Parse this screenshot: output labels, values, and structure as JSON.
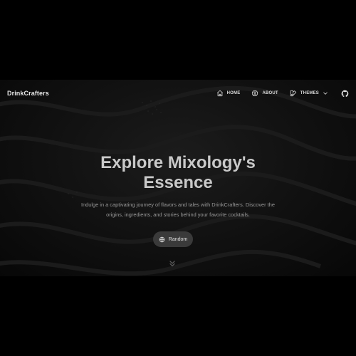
{
  "brand": "DrinkCrafters",
  "nav": {
    "home": "HOME",
    "about": "ABOUT",
    "themes": "THEMES"
  },
  "hero": {
    "title_line1": "Explore Mixology's",
    "title_line2": "Essence",
    "subtitle_line1": "Indulge in a captivating journey of flavors and tales with DrinkCrafters. Discover the",
    "subtitle_line2": "origins, ingredients, and stories behind your favorite cocktails.",
    "random_label": "Random"
  },
  "icons": {
    "home": "home-icon",
    "about": "user-circle-icon",
    "themes": "palette-icon",
    "themes_chevron": "chevron-down-icon",
    "github": "github-icon",
    "random": "globe-icon",
    "scroll": "double-chevron-down-icon"
  },
  "colors": {
    "page_bg": "#000000",
    "hero_bg": "#121212",
    "title": "#c9c9c9",
    "subtitle": "#9a9a9a",
    "button_bg": "#3a3a3a"
  }
}
